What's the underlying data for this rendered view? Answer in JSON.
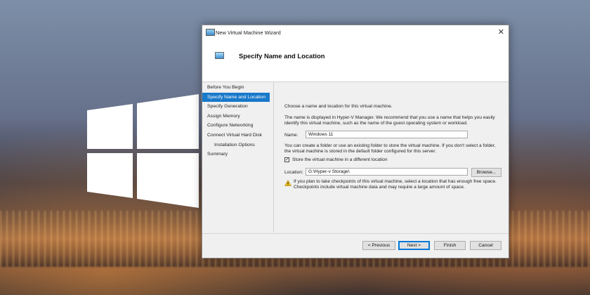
{
  "dialog": {
    "title": "New Virtual Machine Wizard",
    "close_glyph": "✕",
    "header_title": "Specify Name and Location"
  },
  "nav": {
    "items": [
      {
        "label": "Before You Begin"
      },
      {
        "label": "Specify Name and Location"
      },
      {
        "label": "Specify Generation"
      },
      {
        "label": "Assign Memory"
      },
      {
        "label": "Configure Networking"
      },
      {
        "label": "Connect Virtual Hard Disk"
      },
      {
        "label": "Installation Options"
      },
      {
        "label": "Summary"
      }
    ],
    "active_index": 1
  },
  "content": {
    "intro": "Choose a name and location for this virtual machine.",
    "name_help": "The name is displayed in Hyper-V Manager. We recommend that you use a name that helps you easily identify this virtual machine, such as the name of the guest operating system or workload.",
    "name_label": "Name:",
    "name_value": "Windows 11",
    "folder_help": "You can create a folder or use an existing folder to store the virtual machine. If you don't select a folder, the virtual machine is stored in the default folder configured for this server.",
    "store_checkbox_label": "Store the virtual machine in a different location",
    "store_checked": true,
    "location_label": "Location:",
    "location_value": "G:\\Hyper-v Storage\\",
    "browse_label": "Browse...",
    "warning_text": "If you plan to take checkpoints of this virtual machine, select a location that has enough free space. Checkpoints include virtual machine data and may require a large amount of space."
  },
  "buttons": {
    "previous": "< Previous",
    "next": "Next >",
    "finish": "Finish",
    "cancel": "Cancel"
  },
  "colors": {
    "accent": "#1979ca",
    "warning": "#f2c318"
  }
}
